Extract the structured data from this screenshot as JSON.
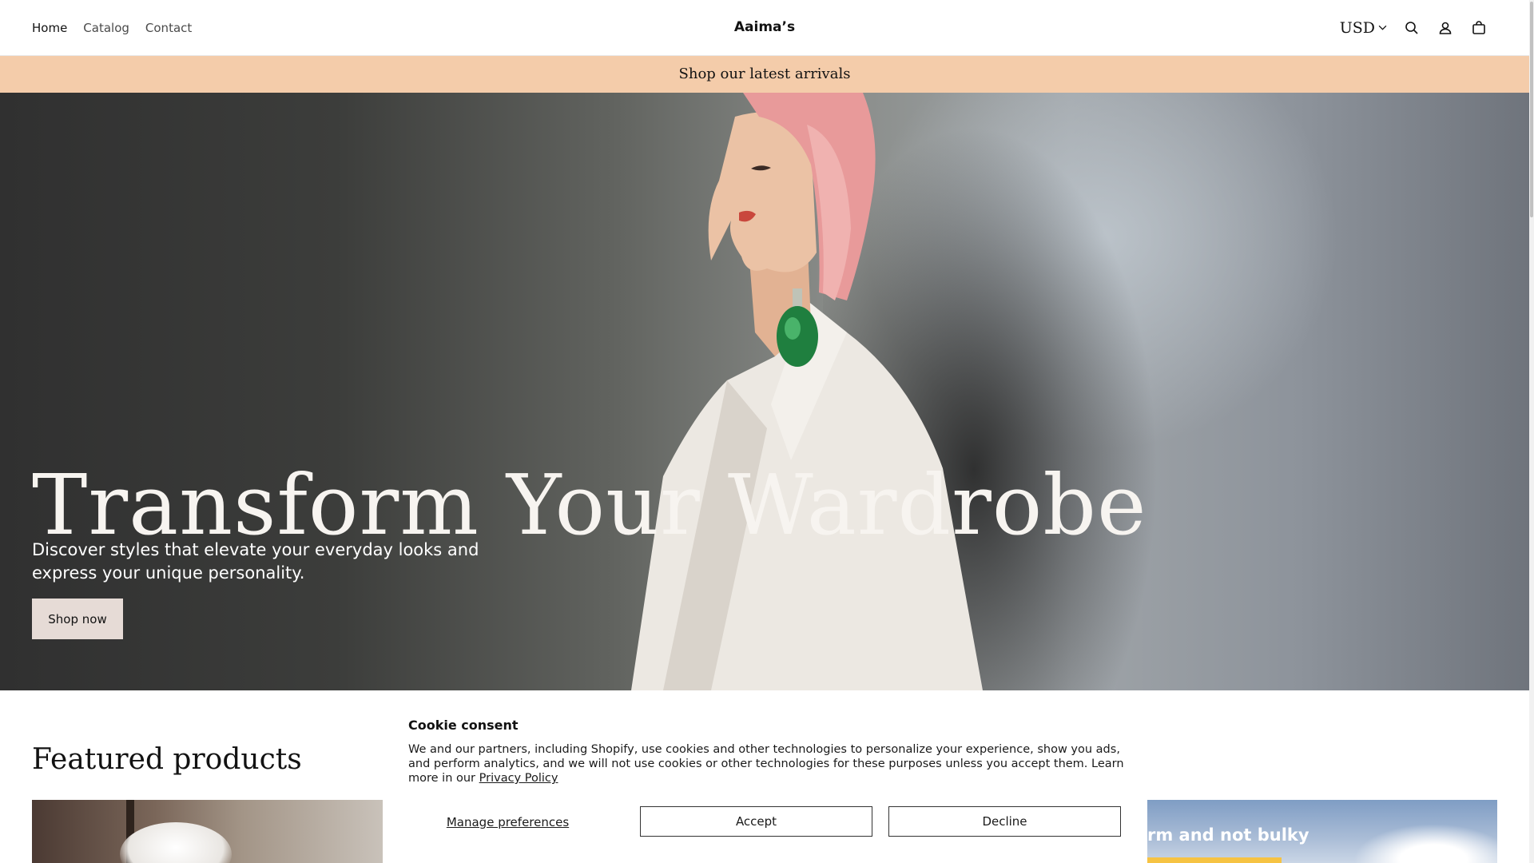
{
  "header": {
    "nav": [
      {
        "label": "Home",
        "active": true
      },
      {
        "label": "Catalog",
        "active": false
      },
      {
        "label": "Contact",
        "active": false
      }
    ],
    "brand": "Aaima’s",
    "currency": "USD",
    "icons": [
      "search-icon",
      "account-icon",
      "cart-icon"
    ]
  },
  "announcement": "Shop our latest arrivals",
  "hero": {
    "title": "Transform Your Wardrobe",
    "subtitle": "Discover styles that elevate your everyday looks and express your unique personality.",
    "button": "Shop now"
  },
  "featured": {
    "title": "Featured products",
    "right_card_text": "rm and not bulky"
  },
  "cookie": {
    "title": "Cookie consent",
    "body": "We and our partners, including Shopify, use cookies and other technologies to personalize your experience, show you ads, and perform analytics, and we will not use cookies or other technologies for these purposes unless you accept them. Learn more in our",
    "link": "Privacy Policy",
    "manage": "Manage preferences",
    "accept": "Accept",
    "decline": "Decline"
  },
  "colors": {
    "announcement_bg": "#f4ccaa",
    "hero_button_bg": "#e6dbd6"
  }
}
